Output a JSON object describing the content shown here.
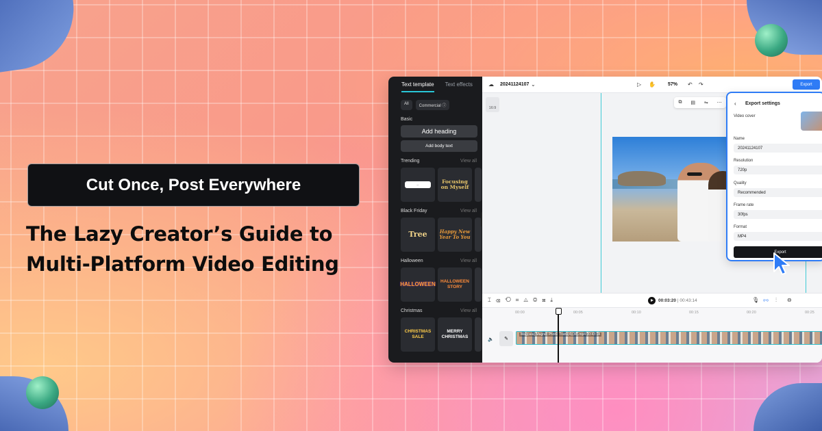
{
  "badge": "Cut Once, Post Everywhere",
  "headline": {
    "line1": "The Lazy Creator’s Guide to",
    "line2": "Multi-Platform Video Editing"
  },
  "editor": {
    "left_panel": {
      "tabs": [
        "Text template",
        "Text effects"
      ],
      "active_tab": "Text template",
      "chips": [
        "All",
        "Commercial ⓘ"
      ],
      "basic": {
        "title": "Basic",
        "add_heading": "Add heading",
        "add_body": "Add body text"
      },
      "sections": [
        {
          "title": "Trending",
          "view_all": "View all",
          "items": [
            "Focusing on Myself"
          ]
        },
        {
          "title": "Black Friday",
          "view_all": "View all",
          "items": [
            "Tree",
            "Happy New Year To You"
          ]
        },
        {
          "title": "Halloween",
          "view_all": "View all",
          "items": [
            "HALLOWEEN",
            "HALLOWEEN STORY"
          ]
        },
        {
          "title": "Christmas",
          "view_all": "View all",
          "items": [
            "CHRISTMAS SALE",
            "MERRY CHRISTMAS"
          ]
        }
      ]
    },
    "topbar": {
      "project_name": "20241124107",
      "zoom": "57%",
      "export_label": "Export"
    },
    "canvas": {
      "ratio": "16:9"
    },
    "export_settings": {
      "title": "Export settings",
      "video_cover_label": "Video cover",
      "name_label": "Name",
      "name_value": "20241124107",
      "resolution_label": "Resolution",
      "resolution_value": "720p",
      "quality_label": "Quality",
      "quality_value": "Recommended",
      "frame_rate_label": "Frame rate",
      "frame_rate_value": "30fps",
      "format_label": "Format",
      "format_value": "MP4",
      "export_button": "Export"
    },
    "playback": {
      "current": "00:03:20",
      "separator": "|",
      "total": "00:43:14"
    },
    "ruler_ticks": [
      "00:00",
      "00:05",
      "00:10",
      "00:15",
      "00:20",
      "00:25"
    ],
    "clip_label": "Mag(sea) Magnet Phone Trans(4)(38).mp4   00:43:14"
  },
  "colors": {
    "accent": "#2f7cf6",
    "timeline_accent": "#2fc0cf",
    "badge_bg": "#101114"
  }
}
